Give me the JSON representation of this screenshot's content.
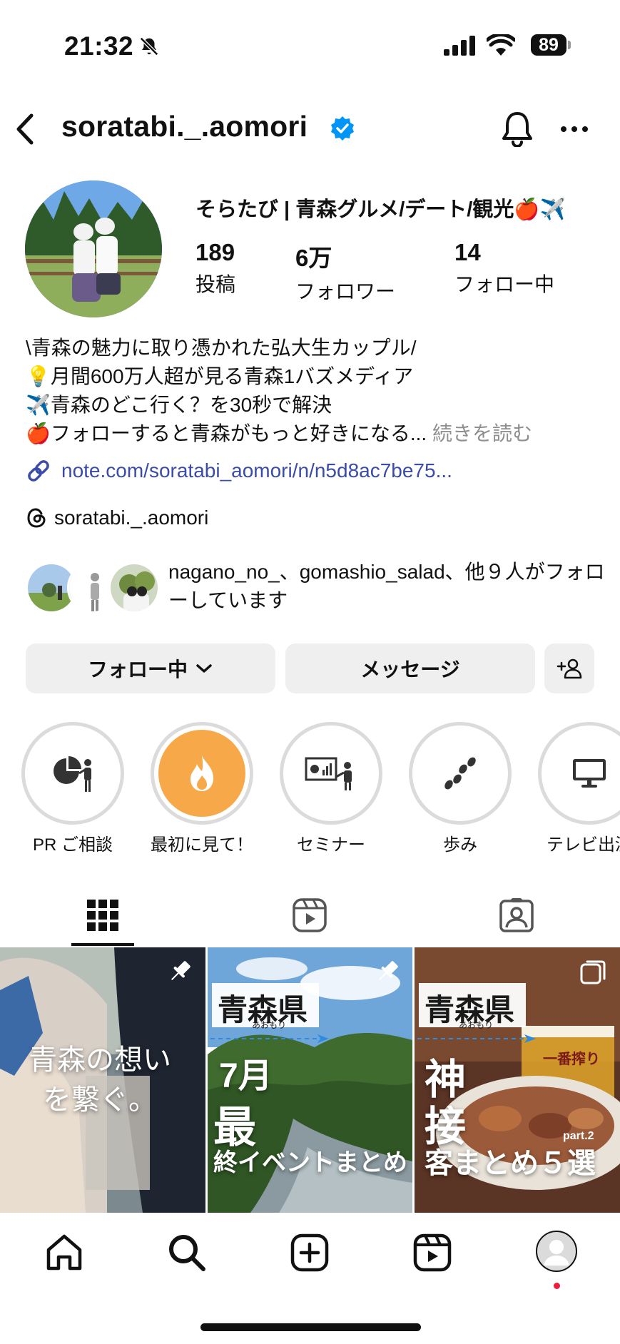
{
  "status_bar": {
    "time": "21:32",
    "battery": "89"
  },
  "header": {
    "username": "soratabi._.aomori"
  },
  "profile": {
    "display_name": "そらたび | 青森グルメ/デート/観光🍎✈️",
    "stats": [
      {
        "value": "189",
        "label": "投稿"
      },
      {
        "value": "6万",
        "label": "フォロワー"
      },
      {
        "value": "14",
        "label": "フォロー中"
      }
    ],
    "bio": [
      "\\青森の魅力に取り憑かれた弘大生カップル/",
      "💡月間600万人超が見る青森1バズメディア",
      "✈️青森のどこ行く？を30秒で解決",
      "🍎フォローすると青森がもっと好きになる..."
    ],
    "read_more": "続きを読む",
    "link": "note.com/soratabi_aomori/n/n5d8ac7be75...",
    "threads_handle": "soratabi._.aomori",
    "followed_by": "nagano_no_、gomashio_salad、他９人がフォローしています"
  },
  "actions": {
    "follow_label": "フォロー中",
    "message_label": "メッセージ"
  },
  "highlights": [
    {
      "label": "PR ご相談",
      "icon": "pie-chart-presenter-icon"
    },
    {
      "label": "最初に見て！",
      "icon": "fire-icon"
    },
    {
      "label": "セミナー",
      "icon": "seminar-board-icon"
    },
    {
      "label": "歩み",
      "icon": "footsteps-icon"
    },
    {
      "label": "テレビ出演",
      "icon": "monitor-icon"
    }
  ],
  "posts": [
    {
      "caption": "青森の想いを繋ぐ。",
      "pinned": true
    },
    {
      "heading": "青森県",
      "reading": "あおもり",
      "lines": [
        "7月",
        "最",
        "終イベントまとめ"
      ],
      "pinned": true
    },
    {
      "heading": "青森県",
      "reading": "あおもり",
      "lines": [
        "神",
        "接",
        "客まとめ５選"
      ],
      "tag": "part.2",
      "sign": "一番搾り",
      "multiple": true
    }
  ],
  "colors": {
    "link": "#3b4ba8",
    "verified": "#0095f6",
    "highlight_fire_bg": "#f7a94a",
    "notification_dot": "#ed1b3d"
  }
}
